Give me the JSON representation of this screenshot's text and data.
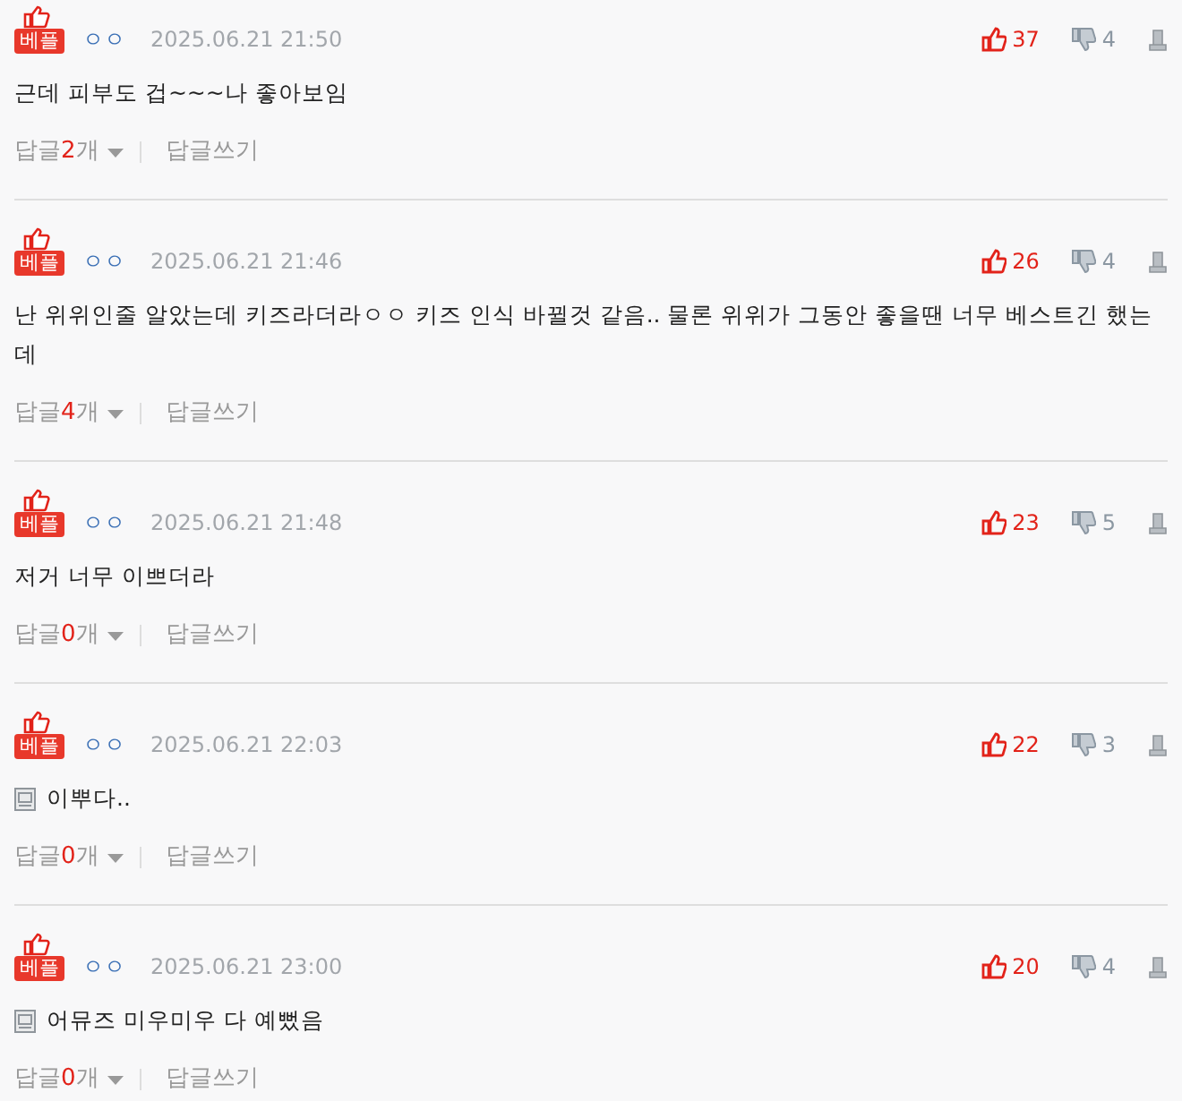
{
  "comments": [
    {
      "badge": "베플",
      "author": "ㅇㅇ",
      "date": "2025.06.21 21:50",
      "likes": "37",
      "dislikes": "4",
      "text": "근데 피부도 겁~~~나 좋아보임",
      "has_image": false,
      "replies": {
        "label": "답글",
        "count": "2",
        "unit": "개"
      },
      "write_reply": "답글쓰기"
    },
    {
      "badge": "베플",
      "author": "ㅇㅇ",
      "date": "2025.06.21 21:46",
      "likes": "26",
      "dislikes": "4",
      "text": "난 위위인줄 알았는데 키즈라더라ㅇㅇ 키즈 인식 바뀔것 같음.. 물론 위위가 그동안 좋을땐 너무 베스트긴 했는데",
      "has_image": false,
      "replies": {
        "label": "답글",
        "count": "4",
        "unit": "개"
      },
      "write_reply": "답글쓰기"
    },
    {
      "badge": "베플",
      "author": "ㅇㅇ",
      "date": "2025.06.21 21:48",
      "likes": "23",
      "dislikes": "5",
      "text": "저거 너무 이쁘더라",
      "has_image": false,
      "replies": {
        "label": "답글",
        "count": "0",
        "unit": "개"
      },
      "write_reply": "답글쓰기"
    },
    {
      "badge": "베플",
      "author": "ㅇㅇ",
      "date": "2025.06.21 22:03",
      "likes": "22",
      "dislikes": "3",
      "text": "이뿌다..",
      "has_image": true,
      "replies": {
        "label": "답글",
        "count": "0",
        "unit": "개"
      },
      "write_reply": "답글쓰기"
    },
    {
      "badge": "베플",
      "author": "ㅇㅇ",
      "date": "2025.06.21 23:00",
      "likes": "20",
      "dislikes": "4",
      "text": "어뮤즈 미우미우 다 예뻤음",
      "has_image": true,
      "replies": {
        "label": "답글",
        "count": "0",
        "unit": "개"
      },
      "write_reply": "답글쓰기"
    }
  ]
}
